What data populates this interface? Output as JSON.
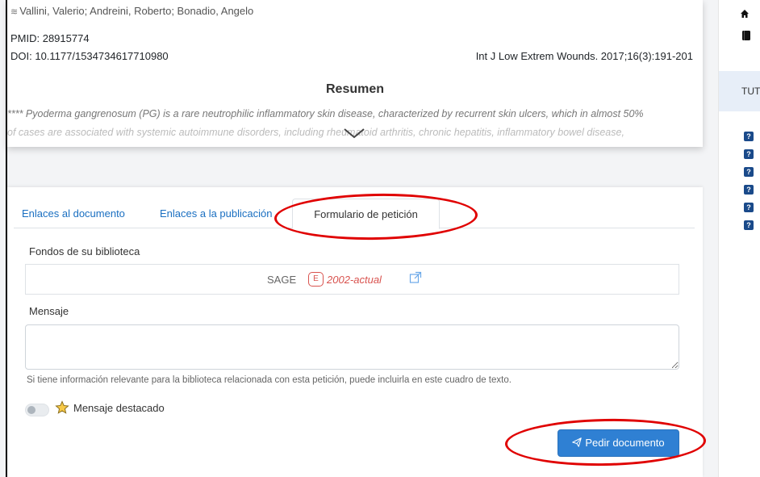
{
  "record": {
    "authors": "Vallini, Valerio; Andreini, Roberto; Bonadio, Angelo",
    "pmid": "PMID: 28915774",
    "doi": "DOI: 10.1177/1534734617710980",
    "journal": "Int J Low Extrem Wounds. 2017;16(3):191-201"
  },
  "abstract": {
    "title": "Resumen",
    "line1": "**** Pyoderma gangrenosum (PG) is a rare neutrophilic inflammatory skin disease, characterized by recurrent skin ulcers, which in almost 50%",
    "line2": "of cases are associated with systemic autoimmune disorders, including rheumatoid arthritis, chronic hepatitis, inflammatory bowel disease,"
  },
  "tabs": {
    "doc_links": "Enlaces al documento",
    "pub_links": "Enlaces a la publicación",
    "request_form": "Formulario de petición"
  },
  "form": {
    "holdings_label": "Fondos de su biblioteca",
    "holdings_provider": "SAGE",
    "holdings_badge": "E",
    "holdings_range": "2002-actual",
    "message_label": "Mensaje",
    "message_value": "",
    "help_text": "Si tiene información relevante para la biblioteca relacionada con esta petición, puede incluirla en este cuadro de texto.",
    "featured_label": "Mensaje destacado",
    "featured_on": false,
    "submit_label": "Pedir documento"
  },
  "sidebar": {
    "tut_label": "TUT",
    "help_items": [
      "?",
      "?",
      "?",
      "?",
      "?",
      "?"
    ]
  },
  "colors": {
    "link": "#1a6fc1",
    "primary_button": "#2f80d3",
    "holdings_red": "#d9534f",
    "annotation_red": "#e00000"
  }
}
